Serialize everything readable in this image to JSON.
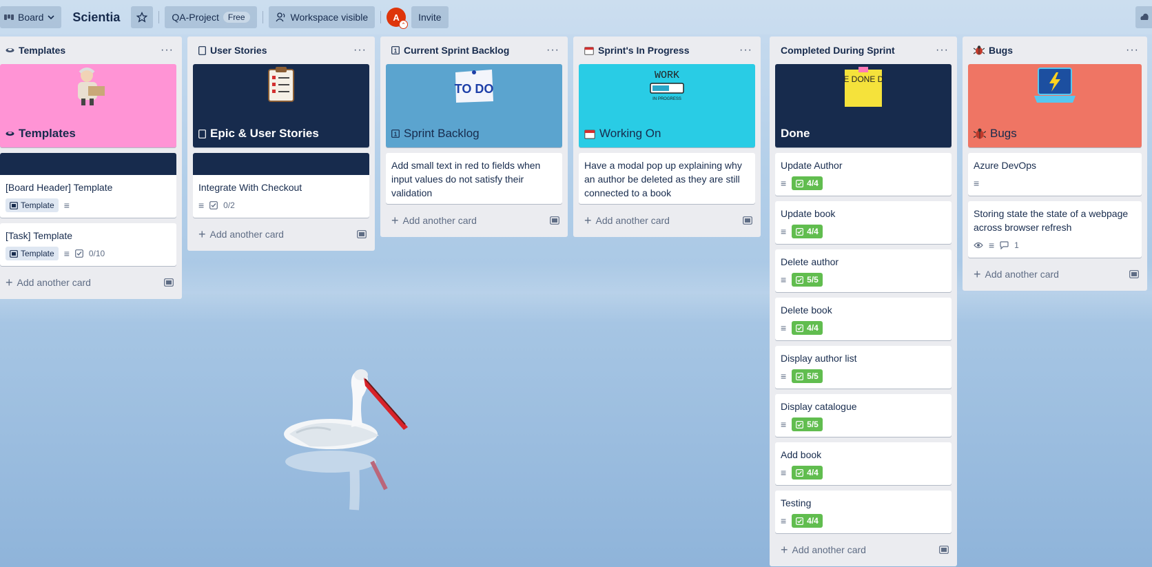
{
  "header": {
    "view_label": "Board",
    "board_title": "Scientia",
    "workspace_label": "QA-Project",
    "workspace_badge": "Free",
    "visibility_label": "Workspace visible",
    "avatar_initial": "A",
    "invite_label": "Invite"
  },
  "add_card_label": "Add another card",
  "lists": {
    "templates": {
      "title": "Templates",
      "cover_title": "Templates",
      "cards": [
        {
          "title": "[Board Header] Template",
          "label": "Template"
        },
        {
          "title": "[Task] Template",
          "label": "Template",
          "checklist": "0/10"
        }
      ]
    },
    "stories": {
      "title": "User Stories",
      "cover_title": "Epic & User Stories",
      "cards": [
        {
          "title": "Integrate With Checkout",
          "checklist": "0/2"
        }
      ]
    },
    "backlog": {
      "title": "Current Sprint Backlog",
      "cover_title": "Sprint Backlog",
      "cover_sticker": "TO DO",
      "cards": [
        {
          "title": "Add small text in red to fields when input values do not satisfy their validation"
        }
      ]
    },
    "progress": {
      "title": "Sprint's In Progress",
      "cover_title": "Working On",
      "cover_sticker": "WORK",
      "cards": [
        {
          "title": "Have a modal pop up explaining why an author be deleted as they are still connected to a book"
        }
      ]
    },
    "done": {
      "title": "Completed During Sprint",
      "cover_title": "Done",
      "cover_sticker": "DONE DONE DONE",
      "cards": [
        {
          "title": "Update Author",
          "checklist": "4/4"
        },
        {
          "title": "Update book",
          "checklist": "4/4"
        },
        {
          "title": "Delete author",
          "checklist": "5/5"
        },
        {
          "title": "Delete book",
          "checklist": "4/4"
        },
        {
          "title": "Display author list",
          "checklist": "5/5"
        },
        {
          "title": "Display catalogue",
          "checklist": "5/5"
        },
        {
          "title": "Add book",
          "checklist": "4/4"
        },
        {
          "title": "Testing",
          "checklist": "4/4"
        }
      ]
    },
    "bugs": {
      "title": "Bugs",
      "cover_title": "Bugs",
      "cards": [
        {
          "title": "Azure DevOps"
        },
        {
          "title": "Storing state the state of a webpage across browser refresh",
          "comments": "1"
        }
      ]
    }
  },
  "colors": {
    "templates_cover": "#ff94d5",
    "stories_cover": "#172b4d",
    "backlog_cover": "#5ba4cf",
    "progress_cover": "#29cce5",
    "done_cover": "#172b4d",
    "bugs_cover": "#ef7564",
    "check_green": "#61bd4f"
  }
}
